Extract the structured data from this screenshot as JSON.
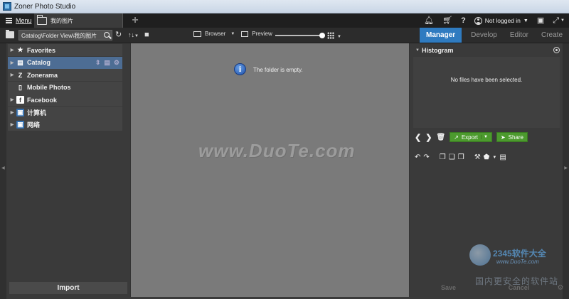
{
  "window": {
    "title": "Zoner Photo Studio"
  },
  "topbar": {
    "menu_label": "Menu",
    "doc_tab_label": "我的图片",
    "add_tab_glyph": "+",
    "login_status": "Not logged in",
    "icons": [
      "bell-icon",
      "cart-icon",
      "help-icon",
      "user-icon",
      "monitor-icon",
      "fullscreen-icon"
    ]
  },
  "toolbar": {
    "path": "Catalog\\Folder View\\我的图片",
    "browser_label": "Browser",
    "preview_label": "Preview",
    "thumb_size_fraction": 1.0,
    "modes": [
      "Manager",
      "Develop",
      "Editor",
      "Create"
    ],
    "active_mode": "Manager"
  },
  "navigator": {
    "items": [
      {
        "label": "Favorites",
        "icon": "star-icon"
      },
      {
        "label": "Catalog",
        "icon": "catalog-icon",
        "selected": true
      },
      {
        "label": "Zonerama",
        "icon": "zonerama-icon"
      },
      {
        "label": "Mobile Photos",
        "icon": "phone-icon"
      },
      {
        "label": "Facebook",
        "icon": "facebook-icon"
      },
      {
        "label": "计算机",
        "icon": "computer-icon"
      },
      {
        "label": "网络",
        "icon": "network-icon"
      }
    ],
    "import_label": "Import"
  },
  "browser": {
    "empty_message": "The folder is empty.",
    "watermark": "www.DuoTe.com"
  },
  "right_panel": {
    "histogram_title": "Histogram",
    "no_selection": "No files have been selected.",
    "export_label": "Export",
    "share_label": "Share",
    "save_label": "Save",
    "cancel_label": "Cancel"
  },
  "corner_watermark": {
    "brand": "2345软件大全",
    "url": "www.DuoTe.com",
    "tagline": "国内更安全的软件站"
  },
  "colors": {
    "accent": "#2f7bc0",
    "selection": "#4d6d94",
    "export_green": "#4c9a2e",
    "canvas": "#7a7a7a"
  }
}
